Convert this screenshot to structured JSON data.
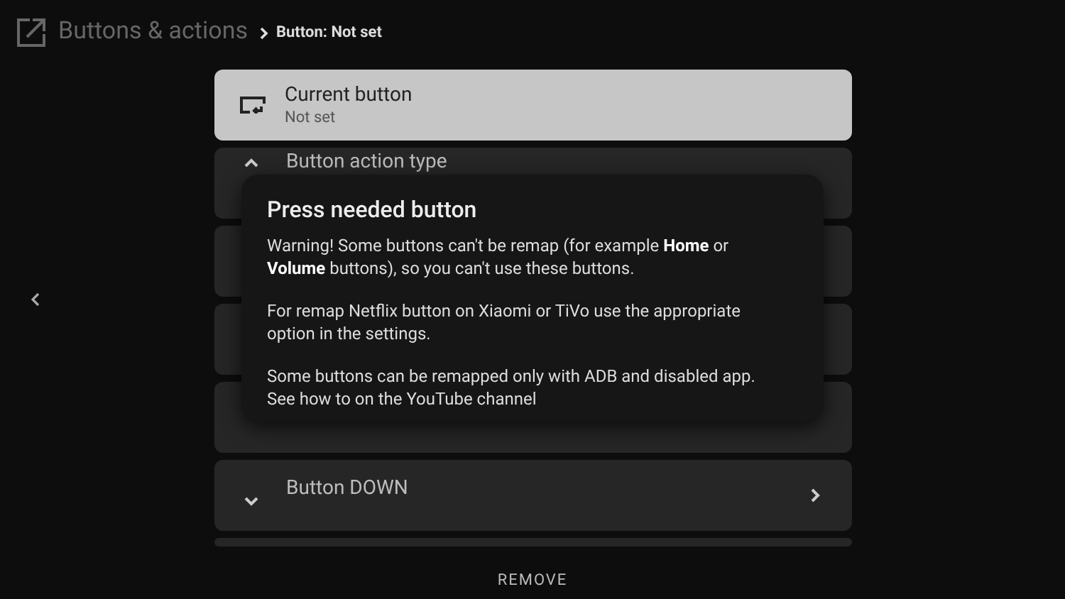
{
  "header": {
    "title": "Buttons & actions",
    "breadcrumb": "Button: Not set"
  },
  "rows": [
    {
      "kind": "current",
      "selected": true,
      "title": "Current button",
      "subtitle": "Not set"
    },
    {
      "kind": "action",
      "selected": false,
      "title": "Button action type"
    },
    {
      "kind": "blank",
      "selected": false
    },
    {
      "kind": "blank",
      "selected": false
    },
    {
      "kind": "blank",
      "selected": false
    },
    {
      "kind": "nav",
      "selected": false,
      "title": "Button DOWN"
    },
    {
      "kind": "blank",
      "selected": false
    }
  ],
  "remove_button": "REMOVE",
  "dialog": {
    "title": "Press needed button",
    "paragraphs": [
      "Warning! Some buttons can't be remap (for example **Home** or **Volume** buttons), so you can't use these buttons.",
      "For remap Netflix button on Xiaomi or TiVo use the appropriate option in the settings.",
      "Some buttons can be remapped only with ADB and disabled app. See how to on the YouTube channel"
    ]
  }
}
